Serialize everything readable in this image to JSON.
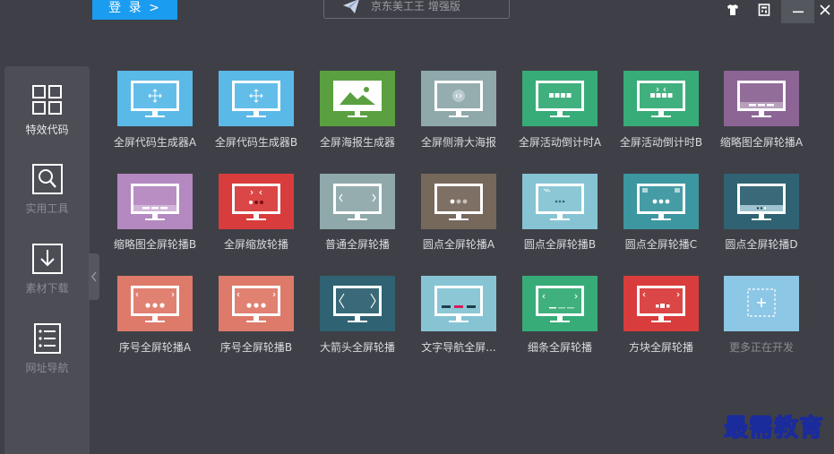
{
  "header": {
    "login_label": "登 录 >",
    "title": "京东美工王 增强版"
  },
  "sidebar": {
    "items": [
      {
        "label": "特效代码",
        "icon": "grid-icon",
        "active": true
      },
      {
        "label": "实用工具",
        "icon": "magnifier-icon",
        "active": false
      },
      {
        "label": "素材下载",
        "icon": "download-icon",
        "active": false
      },
      {
        "label": "网址导航",
        "icon": "list-icon",
        "active": false
      }
    ]
  },
  "tools": [
    {
      "label": "全屏代码生成器A",
      "color": "#5bb9e8"
    },
    {
      "label": "全屏代码生成器B",
      "color": "#5bb9e8"
    },
    {
      "label": "全屏海报生成器",
      "color": "#5aa040"
    },
    {
      "label": "全屏侧滑大海报",
      "color": "#8fa9ab"
    },
    {
      "label": "全屏活动倒计时A",
      "color": "#37ac78"
    },
    {
      "label": "全屏活动倒计时B",
      "color": "#37ac78"
    },
    {
      "label": "缩略图全屏轮播A",
      "color": "#8c6595"
    },
    {
      "label": "缩略图全屏轮播B",
      "color": "#b488c0"
    },
    {
      "label": "全屏缩放轮播",
      "color": "#d93c3c"
    },
    {
      "label": "普通全屏轮播",
      "color": "#8fa9ab"
    },
    {
      "label": "圆点全屏轮播A",
      "color": "#77685c"
    },
    {
      "label": "圆点全屏轮播B",
      "color": "#86c4d4"
    },
    {
      "label": "圆点全屏轮播C",
      "color": "#3c97a0"
    },
    {
      "label": "圆点全屏轮播D",
      "color": "#2f6272"
    },
    {
      "label": "序号全屏轮播A",
      "color": "#de7a6a"
    },
    {
      "label": "序号全屏轮播B",
      "color": "#de7a6a"
    },
    {
      "label": "大箭头全屏轮播",
      "color": "#2f6272"
    },
    {
      "label": "文字导航全屏...",
      "color": "#86c4d4"
    },
    {
      "label": "细条全屏轮播",
      "color": "#37ac78"
    },
    {
      "label": "方块全屏轮播",
      "color": "#d93c3c"
    },
    {
      "label": "更多正在开发",
      "color": "#8cc7e6"
    }
  ],
  "watermark": "最需教育"
}
